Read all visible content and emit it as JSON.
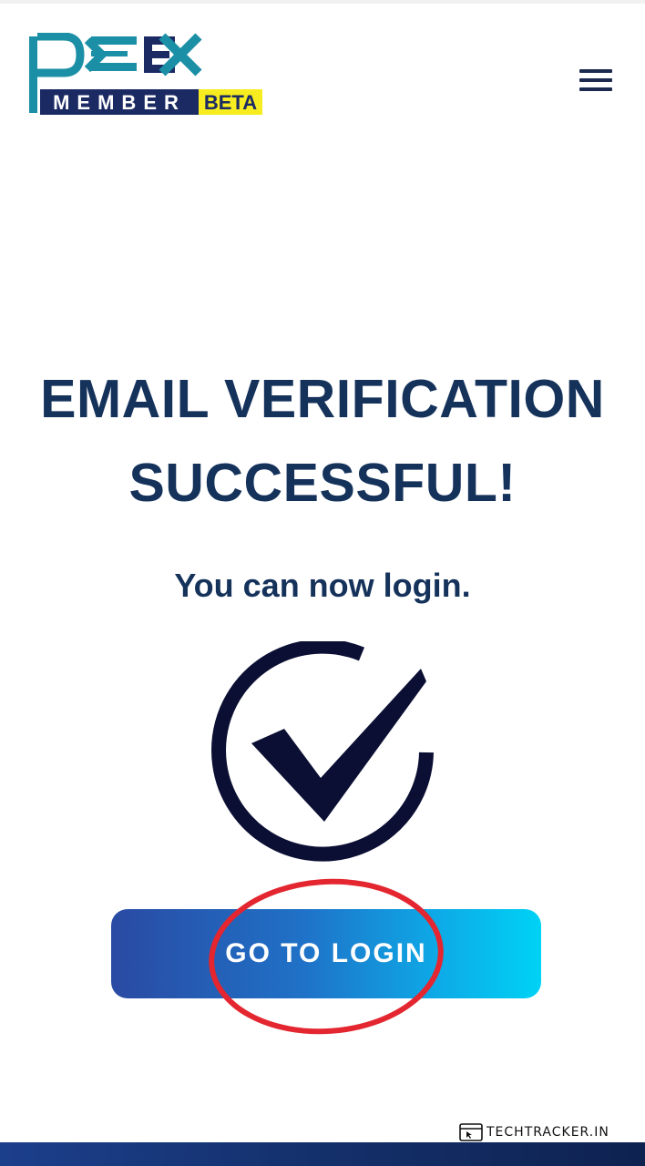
{
  "header": {
    "logo": {
      "wordmark": "PCEX",
      "subtitle": "MEMBER",
      "badge": "BETA"
    },
    "menu_icon": "hamburger-menu-icon"
  },
  "main": {
    "heading_line1": "EMAIL VERIFICATION",
    "heading_line2": "SUCCESSFUL!",
    "subtext": "You can now login.",
    "status_icon": "check-circle-icon",
    "login_button_label": "GO TO LOGIN"
  },
  "watermark": {
    "text": "TECHTRACKER.IN",
    "icon": "browser-cursor-icon"
  },
  "colors": {
    "heading": "#15325b",
    "logo_teal": "#1a8fa5",
    "logo_navy": "#1b2a63",
    "badge_yellow": "#f6ec1f",
    "button_gradient_start": "#2a4aa3",
    "button_gradient_end": "#00d2f5",
    "annotation_red": "#e3262f",
    "check_navy": "#0b0f33"
  }
}
